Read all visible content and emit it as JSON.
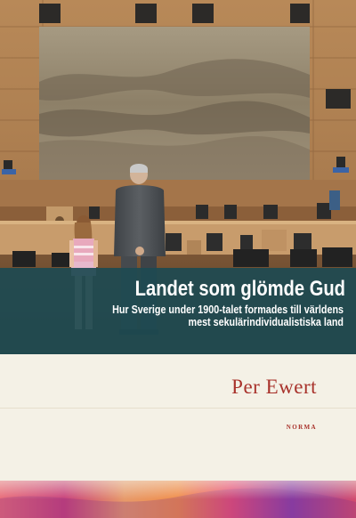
{
  "book": {
    "title": "Landet som glömde Gud",
    "subtitle_line1": "Hur Sverige under 1900-talet formades till världens",
    "subtitle_line2": "mest sekulärindividualistiska land",
    "author": "Per Ewert",
    "publisher": "NORMA"
  },
  "colors": {
    "title_band": "#1e4a52",
    "author_text": "#a8322b",
    "lower_background": "#f4f1e6"
  }
}
